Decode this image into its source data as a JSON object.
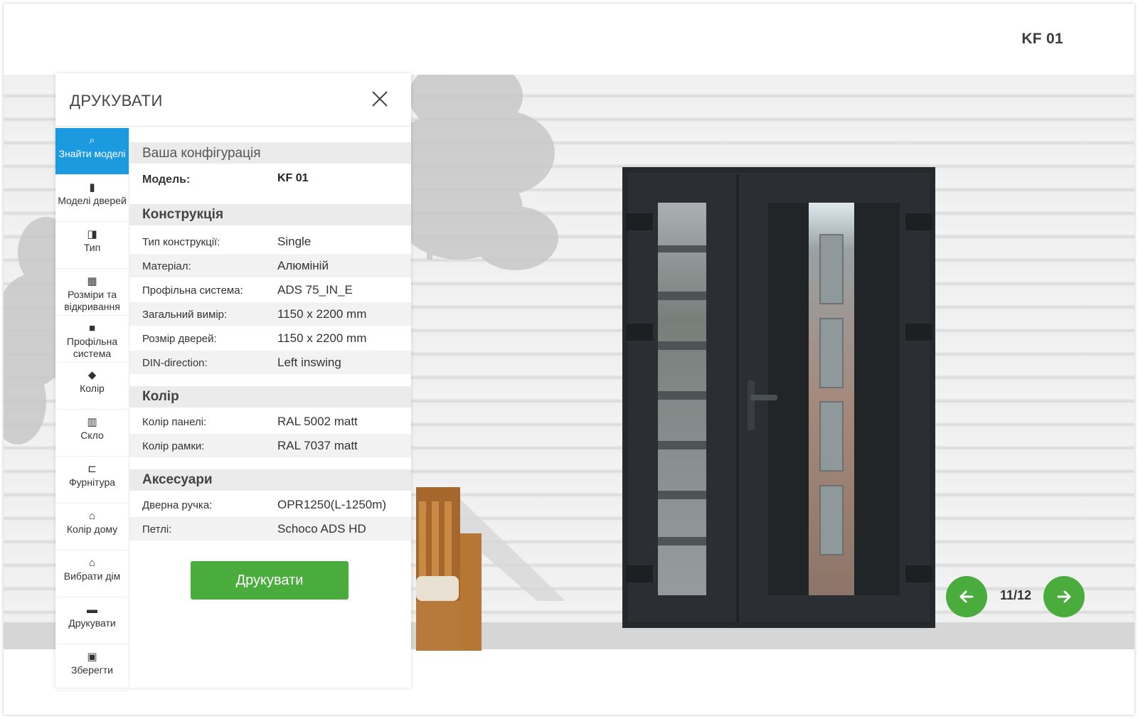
{
  "header": {
    "model_title": "KF 01"
  },
  "panel": {
    "title": "ДРУКУВАТИ",
    "close_icon": "close-icon",
    "sidebar": [
      {
        "label": "Знайти моделі",
        "icon": "search-icon",
        "active": true
      },
      {
        "label": "Моделі дверей",
        "icon": "door-icon"
      },
      {
        "label": "Тип",
        "icon": "door-type-icon"
      },
      {
        "label": "Розміри та відкривання",
        "icon": "size-icon"
      },
      {
        "label": "Профільна система",
        "icon": "profile-icon"
      },
      {
        "label": "Колір",
        "icon": "paint-bucket-icon"
      },
      {
        "label": "Скло",
        "icon": "glass-icon"
      },
      {
        "label": "Фурнітура",
        "icon": "handle-icon"
      },
      {
        "label": "Колір дому",
        "icon": "house-color-icon"
      },
      {
        "label": "Вибрати дім",
        "icon": "house-icon"
      },
      {
        "label": "Друкувати",
        "icon": "printer-icon"
      },
      {
        "label": "Зберегти",
        "icon": "save-icon"
      }
    ],
    "config": {
      "heading": "Ваша конфігурація",
      "model_label": "Модель:",
      "model_value": "KF 01",
      "sections": [
        {
          "title": "Конструкція",
          "rows": [
            {
              "label": "Тип конструкції:",
              "value": "Single"
            },
            {
              "label": "Матеріал:",
              "value": "Алюміній"
            },
            {
              "label": "Профільна система:",
              "value": "ADS 75_IN_E"
            },
            {
              "label": "Загальний вимір:",
              "value": "1150 x 2200 mm"
            },
            {
              "label": "Розмір дверей:",
              "value": "1150 x 2200 mm"
            },
            {
              "label": "DIN-direction:",
              "value": "Left inswing"
            }
          ]
        },
        {
          "title": "Колір",
          "rows": [
            {
              "label": "Колір панелі:",
              "value": "RAL 5002 matt"
            },
            {
              "label": "Колір рамки:",
              "value": "RAL 7037 matt"
            }
          ]
        },
        {
          "title": "Аксесуари",
          "rows": [
            {
              "label": "Дверна ручка:",
              "value": "OPR1250(L-1250m)"
            },
            {
              "label": "Петлі:",
              "value": "Schoco ADS HD"
            }
          ]
        }
      ]
    },
    "print_button": "Друкувати"
  },
  "pager": {
    "text": "11/12",
    "prev_icon": "arrow-left-icon",
    "next_icon": "arrow-right-icon"
  },
  "colors": {
    "accent_green": "#4aac3d",
    "active_blue": "#1c9ae0",
    "door_frame": "#2b2f33"
  }
}
